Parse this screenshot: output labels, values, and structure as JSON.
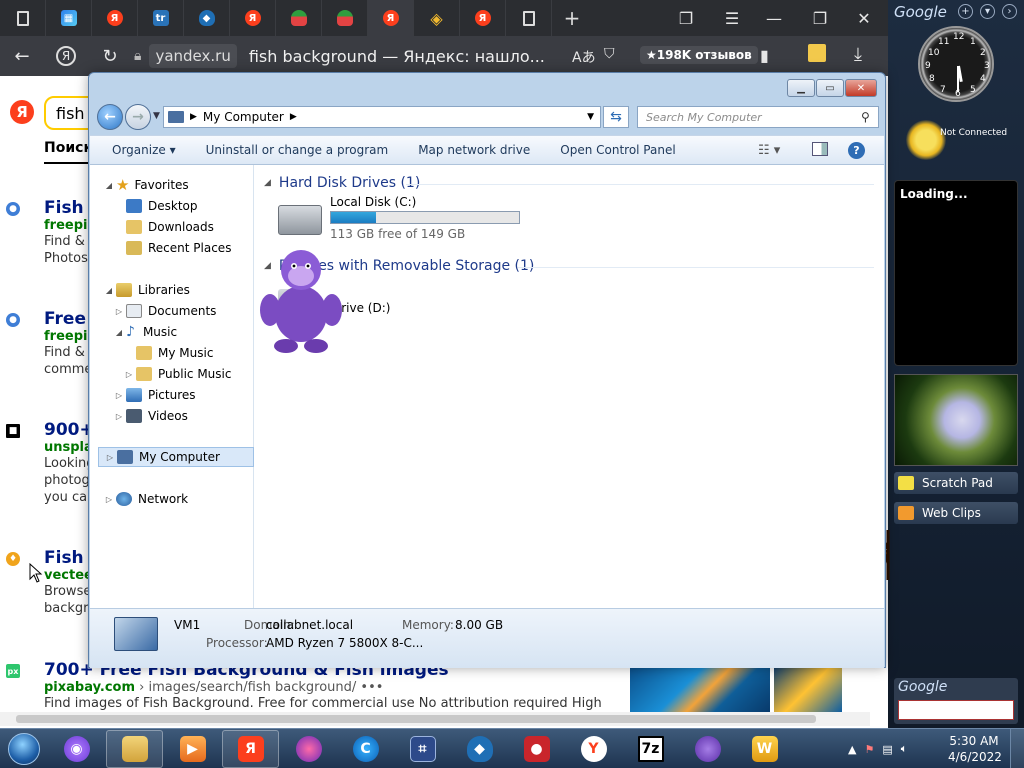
{
  "browser": {
    "address": {
      "domain": "yandex.ru",
      "title": "fish background — Яндекс: нашло...",
      "reviews": "★198K отзывов"
    }
  },
  "yandex": {
    "search_value": "fish b",
    "tab_label": "Поиск",
    "results": [
      {
        "title": "Fish b",
        "host": "freepik",
        "snippet1": "Find & D",
        "snippet2": "Photos"
      },
      {
        "title": "Free b",
        "host": "freepik",
        "snippet1": "Find & D",
        "snippet2": "comme"
      },
      {
        "title": "900+",
        "host": "unspla",
        "snippet1": "Looking",
        "snippet2": "photog",
        "snippet3": "you car"
      },
      {
        "title": "Fish b",
        "host": "vectee",
        "snippet1": "Browse",
        "snippet2": "backgr"
      },
      {
        "title": "700+ Free Fish Background & Fish images",
        "host": "pixabay.com",
        "path": " › images/search/fish background/ •••",
        "snippet1": "Find images of Fish Background. Free for commercial use No attribution required High"
      }
    ]
  },
  "sidebar": {
    "brand": "Google",
    "not_connected": "Not Connected",
    "feed_loading": "Loading...",
    "scratch_pad": "Scratch Pad",
    "web_clips": "Web Clips",
    "search_brand": "Google",
    "clock_numbers": [
      "12",
      "1",
      "2",
      "3",
      "4",
      "5",
      "6",
      "7",
      "8",
      "9",
      "10",
      "11"
    ]
  },
  "explorer": {
    "breadcrumb": "My Computer",
    "search_placeholder": "Search My Computer",
    "toolbar": {
      "organize": "Organize ▾",
      "uninstall": "Uninstall or change a program",
      "map_drive": "Map network drive",
      "control_panel": "Open Control Panel"
    },
    "nav": {
      "favorites": "Favorites",
      "desktop": "Desktop",
      "downloads": "Downloads",
      "recent": "Recent Places",
      "libraries": "Libraries",
      "documents": "Documents",
      "music": "Music",
      "my_music": "My Music",
      "public_music": "Public Music",
      "pictures": "Pictures",
      "videos": "Videos",
      "my_computer": "My Computer",
      "network": "Network"
    },
    "groups": {
      "hdd": "Hard Disk Drives (1)",
      "removable": "Devices with Removable Storage (1)"
    },
    "drives": {
      "c_name": "Local Disk (C:)",
      "c_free": "113 GB free of 149 GB",
      "c_used_fraction": 0.24,
      "d_name": "Drive (D:)"
    },
    "details": {
      "name": "VM1",
      "domain_label": "Domain:",
      "domain_value": "collabnet.local",
      "memory_label": "Memory:",
      "memory_value": "8.00 GB",
      "processor_label": "Processor:",
      "processor_value": "AMD Ryzen 7 5800X 8-C..."
    }
  },
  "taskbar": {
    "time": "5:30 AM",
    "date": "4/6/2022"
  },
  "colors": {
    "yandex_red": "#fc3f1d",
    "link_blue": "#001a80",
    "host_green": "#007700",
    "drive_bar": "#1b7cc2"
  }
}
